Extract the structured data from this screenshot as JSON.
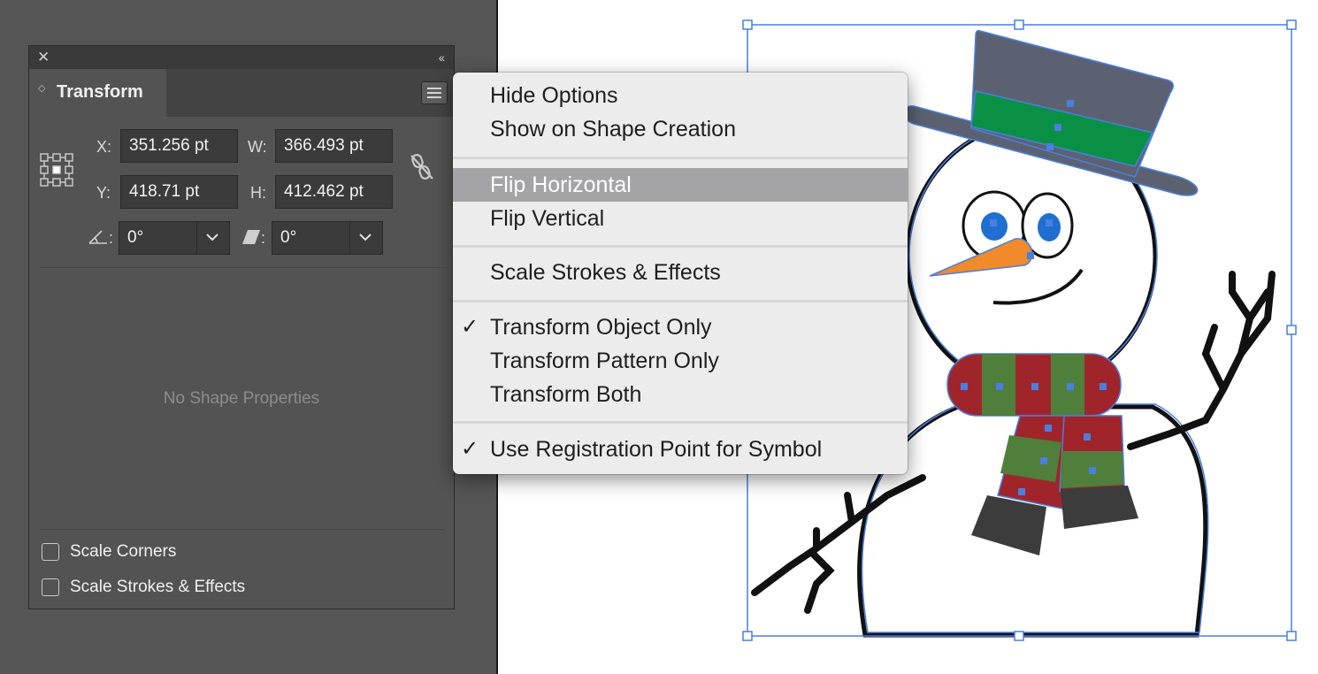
{
  "panel": {
    "close_icon": "close-icon",
    "collapse_icon": "double-chevron-icon",
    "tab_label": "Transform",
    "x_label": "X:",
    "x_value": "351.256 pt",
    "w_label": "W:",
    "w_value": "366.493 pt",
    "y_label": "Y:",
    "y_value": "418.71 pt",
    "h_label": "H:",
    "h_value": "412.462 pt",
    "rotate_label": ":",
    "rotate_value": "0°",
    "shear_label": ":",
    "shear_value": "0°",
    "no_shape_text": "No Shape Properties",
    "scale_corners_label": "Scale Corners",
    "scale_strokes_label": "Scale Strokes & Effects"
  },
  "menu": {
    "hide_options": "Hide Options",
    "show_on_shape_creation": "Show on Shape Creation",
    "flip_horizontal": "Flip Horizontal",
    "flip_vertical": "Flip Vertical",
    "scale_strokes_effects": "Scale Strokes & Effects",
    "transform_object_only": "Transform Object Only",
    "transform_pattern_only": "Transform Pattern Only",
    "transform_both": "Transform Both",
    "use_registration_point": "Use Registration Point for Symbol",
    "checkmark": "✓",
    "highlighted_item": "Flip Horizontal"
  },
  "colors": {
    "selection_blue": "#4a7fe0",
    "hat_gray": "#5b6170",
    "hat_band_green": "#0a9045",
    "scarf_red": "#a0252b",
    "scarf_green": "#4f7f3a",
    "carrot_orange": "#f08a2a",
    "eye_blue": "#1e6fd0"
  }
}
